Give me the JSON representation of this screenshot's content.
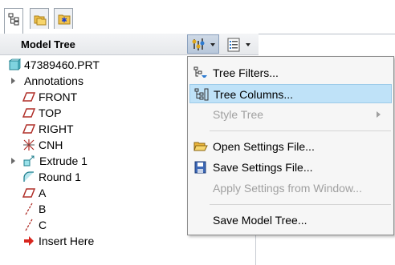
{
  "tabs": [
    {
      "icon": "model-tree-icon"
    },
    {
      "icon": "folder-browser-icon"
    },
    {
      "icon": "favorites-icon"
    }
  ],
  "header": {
    "title": "Model Tree",
    "settings_icon": "tree-settings-icon",
    "show_icon": "show-columns-icon"
  },
  "tree": {
    "items": [
      {
        "label": "47389460.PRT",
        "icon": "part-icon"
      },
      {
        "label": "Annotations",
        "icon": "expander"
      },
      {
        "label": "FRONT",
        "icon": "datum-plane-icon"
      },
      {
        "label": "TOP",
        "icon": "datum-plane-icon"
      },
      {
        "label": "RIGHT",
        "icon": "datum-plane-icon"
      },
      {
        "label": "CNH",
        "icon": "coordinate-system-icon"
      },
      {
        "label": "Extrude 1",
        "icon": "extrude-icon"
      },
      {
        "label": "Round 1",
        "icon": "round-icon"
      },
      {
        "label": "A",
        "icon": "datum-plane-icon"
      },
      {
        "label": "B",
        "icon": "datum-axis-icon"
      },
      {
        "label": "C",
        "icon": "datum-axis-icon"
      },
      {
        "label": "Insert Here",
        "icon": "insert-here-arrow-icon"
      }
    ]
  },
  "menu": {
    "items": [
      {
        "label": "Tree Filters...",
        "icon": "tree-filters-icon"
      },
      {
        "label": "Tree Columns...",
        "icon": "tree-columns-icon"
      },
      {
        "label": "Style Tree"
      },
      {
        "label": "Open Settings File...",
        "icon": "open-folder-icon"
      },
      {
        "label": "Save Settings File...",
        "icon": "save-disk-icon"
      },
      {
        "label": "Apply Settings from Window..."
      },
      {
        "label": "Save Model Tree..."
      }
    ]
  },
  "colors": {
    "highlight": "#bfe2f8",
    "plane": "#b0302a",
    "part": "#2c9fb0",
    "insert_arrow": "#d8261e"
  }
}
